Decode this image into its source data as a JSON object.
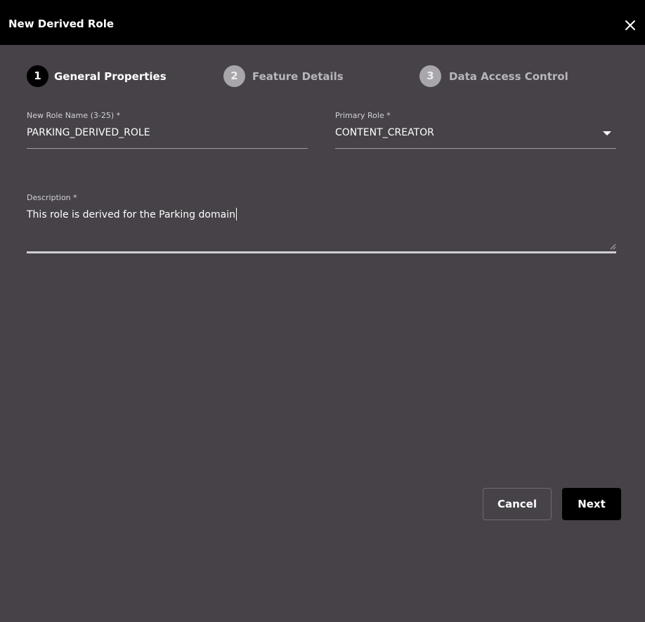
{
  "dialog": {
    "title": "New Derived Role",
    "close_icon": "close-icon"
  },
  "stepper": {
    "steps": [
      {
        "number": "1",
        "label": "General Properties",
        "state": "active"
      },
      {
        "number": "2",
        "label": "Feature Details",
        "state": "inactive"
      },
      {
        "number": "3",
        "label": "Data Access Control",
        "state": "inactive"
      }
    ]
  },
  "form": {
    "role_name": {
      "label": "New Role Name (3-25) *",
      "value": "PARKING_DERIVED_ROLE"
    },
    "primary_role": {
      "label": "Primary Role *",
      "value": "CONTENT_CREATOR",
      "icon": "chevron-down-icon"
    },
    "description": {
      "label": "Description *",
      "value": "This role is derived for the Parking domain"
    }
  },
  "actions": {
    "cancel_label": "Cancel",
    "next_label": "Next"
  },
  "colors": {
    "background": "#464248",
    "titlebar": "#000000",
    "active_step": "#000000",
    "inactive_step": "#a8a6ab",
    "primary_button": "#000000"
  }
}
